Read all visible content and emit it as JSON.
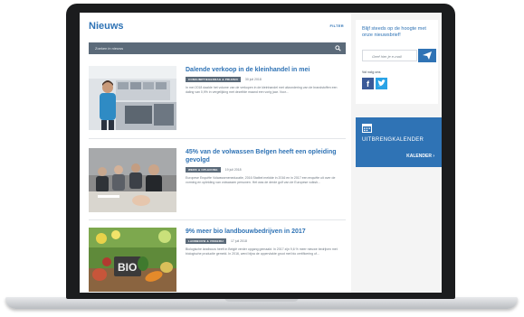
{
  "page": {
    "title": "Nieuws",
    "filter_label": "FILTER"
  },
  "search": {
    "placeholder": "Zoeken in nieuws",
    "icon": "search-icon"
  },
  "articles": [
    {
      "title": "Dalende verkoop in de kleinhandel in mei",
      "tag": "CONSUMPTIEGEDRAG & PRIJZEN",
      "date": "30 juli 2018",
      "excerpt": "In mei 2018 daalde het volume van de verkopen in de kleinhandel met uitzondering van de brandstoffen een daling van 0,9% in vergelijking met dezelfde maand een vorig jaar. Voor..."
    },
    {
      "title": "45% van de volwassen Belgen heeft een opleiding gevolgd",
      "tag": "WERK & OPLEIDING",
      "date": "19 juli 2018",
      "excerpt": "Europese Enquête Volwasseneneducatie, 2016 Statbel meldde in 2016 en in 2017 een enquête uit over de vorming en opleiding van volwassen personen. Het was de derde golf van de Europese volksh..."
    },
    {
      "title": "9% meer bio landbouwbedrijven in 2017",
      "tag": "LANDBOUW & VISSERIJ",
      "date": "17 juli 2018",
      "excerpt": "Biologische landbouw heeft in België verder opgang gemaakt. In 2017 zijn 9,6 % meer nieuwe bedrijven met biologische productie gemeld. In 2016, werd bijna de oppervlakte groot met bio certificering of..."
    }
  ],
  "sidebar": {
    "newsletter_text": "Blijf steeds op de hoogte met onze nieuwsbrief!",
    "email_placeholder": "Geef hier je e-mail",
    "follow_label": "Vol volg ons",
    "facebook_letter": "f",
    "calendar_title": "UITBRENGKALENDER",
    "calendar_link": "KALENDER ›"
  },
  "colors": {
    "brand_blue": "#2f73b5",
    "search_bar": "#5b6a79",
    "facebook": "#3b5a98",
    "twitter": "#2aa3e6"
  }
}
